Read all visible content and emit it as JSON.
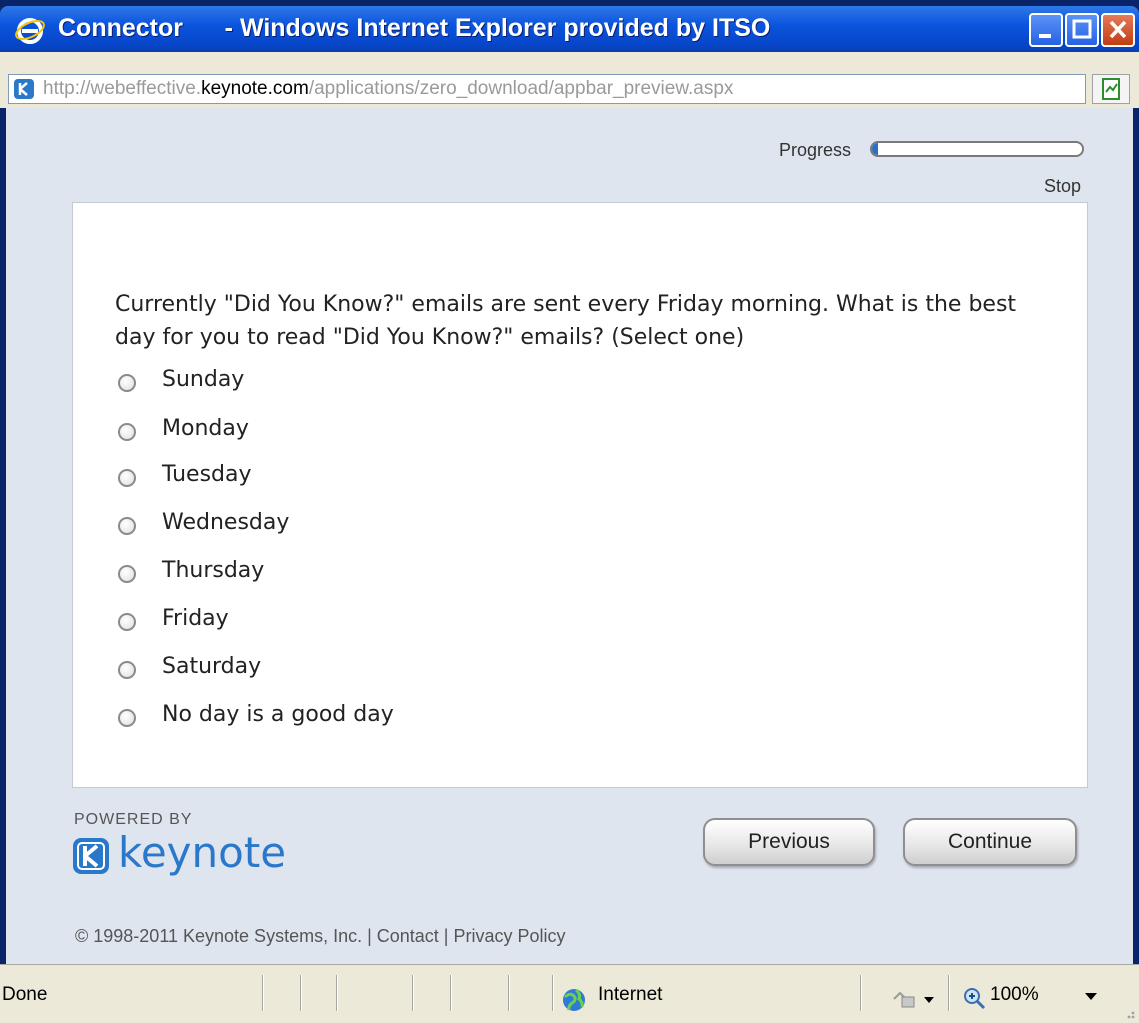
{
  "window": {
    "title": "Connector      - Windows Internet Explorer provided by ITSO"
  },
  "address": {
    "url_prefix": "http://webeffective.",
    "url_host": "keynote.com",
    "url_path": "/applications/zero_download/appbar_preview.aspx"
  },
  "survey": {
    "progress_label": "Progress",
    "progress_fraction": 0.03,
    "stop_label": "Stop",
    "question": "Currently \"Did You Know?\" emails are sent every Friday morning. What is the best day for you to read \"Did You Know?\" emails? (Select one)",
    "options": [
      "Sunday",
      "Monday",
      "Tuesday",
      "Wednesday",
      "Thursday",
      "Friday",
      "Saturday",
      "No day is a good day"
    ],
    "previous_label": "Previous",
    "continue_label": "Continue"
  },
  "footer": {
    "powered_by": "POWERED BY",
    "brand": "keynote",
    "copyright": "© 1998-2011 Keynote Systems, Inc.  |  Contact  |  Privacy Policy"
  },
  "status": {
    "left_text": "Done",
    "zone": "Internet",
    "zoom": "100%"
  },
  "colors": {
    "accent": "#2a78c9",
    "titlebar": "#0c55de",
    "background": "#dfe5ef"
  }
}
